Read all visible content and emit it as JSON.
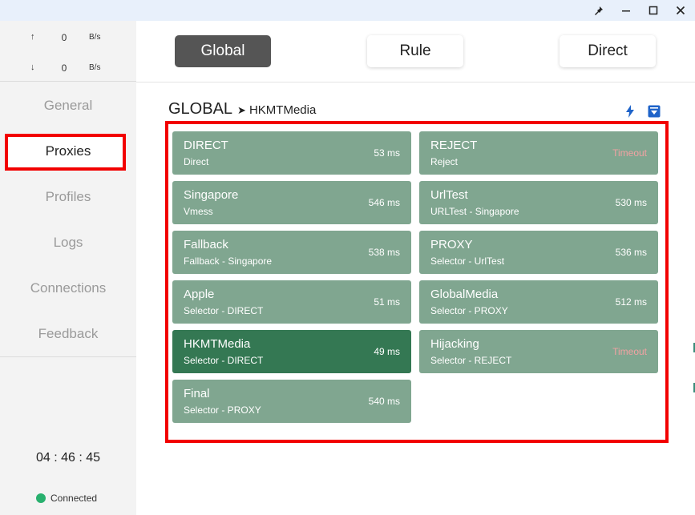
{
  "window": {
    "controls": {
      "pin_icon": "pin-icon",
      "minimize_icon": "minimize-icon",
      "maximize_icon": "maximize-icon",
      "close_icon": "close-icon"
    }
  },
  "sidebar": {
    "traffic": {
      "upload": {
        "arrow": "↑",
        "value": "0",
        "unit": "B/s"
      },
      "download": {
        "arrow": "↓",
        "value": "0",
        "unit": "B/s"
      }
    },
    "nav": [
      {
        "label": "General",
        "active": false
      },
      {
        "label": "Proxies",
        "active": true
      },
      {
        "label": "Profiles",
        "active": false
      },
      {
        "label": "Logs",
        "active": false
      },
      {
        "label": "Connections",
        "active": false
      },
      {
        "label": "Feedback",
        "active": false
      }
    ],
    "clock": "04 : 46 : 45",
    "status": {
      "label": "Connected",
      "color": "#28b06e"
    }
  },
  "modes": [
    {
      "label": "Global",
      "active": true
    },
    {
      "label": "Rule",
      "active": false
    },
    {
      "label": "Direct",
      "active": false
    }
  ],
  "group": {
    "name": "GLOBAL",
    "separator": "➤",
    "selected": "HKMTMedia",
    "tools": {
      "speedtest_icon": "lightning-icon",
      "collapse_icon": "collapse-icon"
    }
  },
  "proxies": [
    {
      "name": "DIRECT",
      "type": "Direct",
      "delay": "53 ms",
      "timeout": false,
      "selected": false
    },
    {
      "name": "REJECT",
      "type": "Reject",
      "delay": "Timeout",
      "timeout": true,
      "selected": false
    },
    {
      "name": "Singapore",
      "type": "Vmess",
      "delay": "546 ms",
      "timeout": false,
      "selected": false
    },
    {
      "name": "UrlTest",
      "type": "URLTest - Singapore",
      "delay": "530 ms",
      "timeout": false,
      "selected": false
    },
    {
      "name": "Fallback",
      "type": "Fallback - Singapore",
      "delay": "538 ms",
      "timeout": false,
      "selected": false
    },
    {
      "name": "PROXY",
      "type": "Selector - UrlTest",
      "delay": "536 ms",
      "timeout": false,
      "selected": false
    },
    {
      "name": "Apple",
      "type": "Selector - DIRECT",
      "delay": "51 ms",
      "timeout": false,
      "selected": false
    },
    {
      "name": "GlobalMedia",
      "type": "Selector - PROXY",
      "delay": "512 ms",
      "timeout": false,
      "selected": false
    },
    {
      "name": "HKMTMedia",
      "type": "Selector - DIRECT",
      "delay": "49 ms",
      "timeout": false,
      "selected": true
    },
    {
      "name": "Hijacking",
      "type": "Selector - REJECT",
      "delay": "Timeout",
      "timeout": true,
      "selected": false
    },
    {
      "name": "Final",
      "type": "Selector - PROXY",
      "delay": "540 ms",
      "timeout": false,
      "selected": false
    }
  ],
  "colors": {
    "card": "#80a690",
    "card_selected": "#347853",
    "timeout": "#f1a2a2",
    "highlight_frame": "#f20000",
    "active_mode": "#555555"
  }
}
